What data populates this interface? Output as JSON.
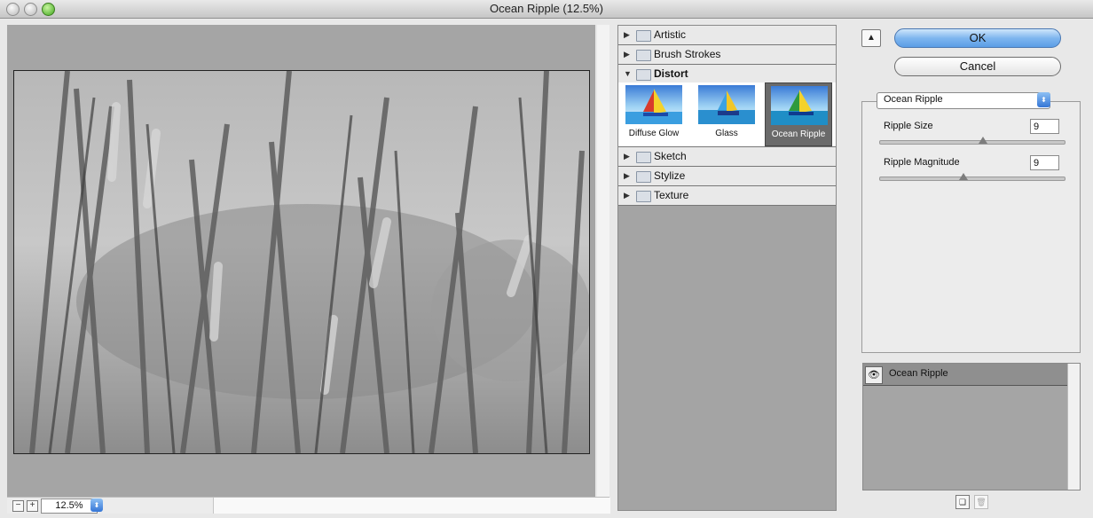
{
  "window": {
    "title": "Ocean Ripple (12.5%)"
  },
  "zoom": {
    "minus": "−",
    "plus": "+",
    "value": "12.5%"
  },
  "filter_categories": [
    {
      "label": "Artistic",
      "open": false
    },
    {
      "label": "Brush Strokes",
      "open": false
    },
    {
      "label": "Distort",
      "open": true
    },
    {
      "label": "Sketch",
      "open": false
    },
    {
      "label": "Stylize",
      "open": false
    },
    {
      "label": "Texture",
      "open": false
    }
  ],
  "distort_filters": [
    {
      "label": "Diffuse Glow",
      "selected": false
    },
    {
      "label": "Glass",
      "selected": false
    },
    {
      "label": "Ocean Ripple",
      "selected": true
    }
  ],
  "buttons": {
    "ok": "OK",
    "cancel": "Cancel",
    "collapse": "▲"
  },
  "filter_select": {
    "value": "Ocean Ripple",
    "arrow": "⬍"
  },
  "params": [
    {
      "label": "Ripple Size",
      "value": "9",
      "slider_fraction": 0.56
    },
    {
      "label": "Ripple Magnitude",
      "value": "9",
      "slider_fraction": 0.45
    }
  ],
  "effect_layers": [
    {
      "label": "Ocean Ripple",
      "visible": true
    }
  ],
  "icons": {
    "eye": "👁",
    "new_layer": "❏",
    "delete_layer": "🗑"
  },
  "colors": {
    "ok_button": "#7fb6ef",
    "selected_thumb": "#6a6a6a",
    "panel_gray": "#a5a5a5"
  }
}
